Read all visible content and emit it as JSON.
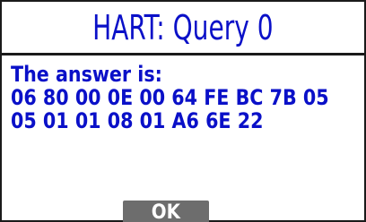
{
  "header": {
    "title": "HART: Query 0"
  },
  "body": {
    "answer_label": "The answer is:",
    "hex_line_1": "06 80 00 0E 00 64 FE BC 7B 05",
    "hex_line_2": "05 01 01 08 01 A6 6E 22"
  },
  "footer": {
    "ok_label": "OK"
  },
  "colors": {
    "accent": "#0a10c8",
    "button": "#6d6d6d",
    "border": "#1a1a1a"
  }
}
